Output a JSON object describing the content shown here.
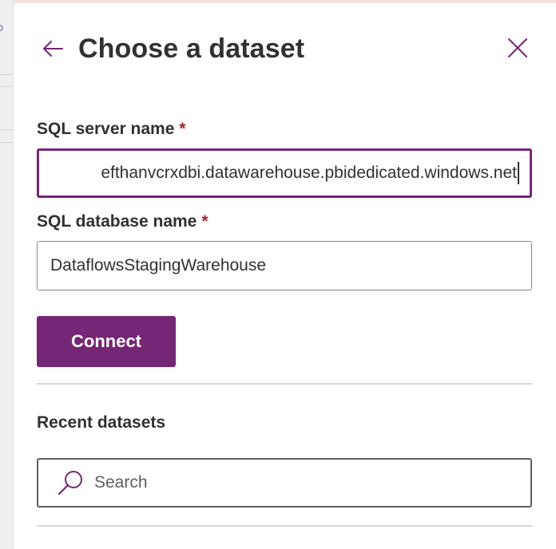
{
  "panel": {
    "title": "Choose a dataset"
  },
  "form": {
    "server": {
      "label": "SQL server name",
      "required_mark": "*",
      "value": "efthanvcrxdbi.datawarehouse.pbidedicated.windows.net"
    },
    "database": {
      "label": "SQL database name",
      "required_mark": "*",
      "value": "DataflowsStagingWarehouse"
    },
    "connect_label": "Connect"
  },
  "recent": {
    "title": "Recent datasets",
    "search_placeholder": "Search"
  },
  "icons": {
    "back": "arrow-left-icon",
    "close": "close-icon",
    "search": "search-icon"
  },
  "colors": {
    "accent": "#742774",
    "required": "#a4262c",
    "text": "#323130",
    "divider": "#d6d6d6"
  }
}
